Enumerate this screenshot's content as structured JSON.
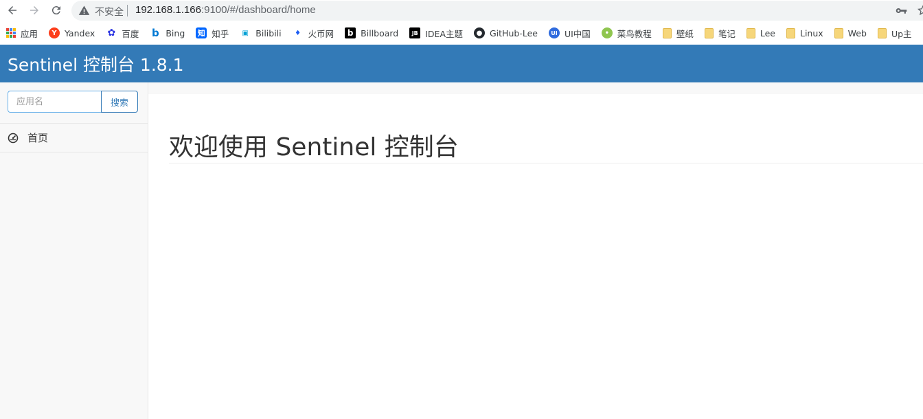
{
  "browser": {
    "security_label": "不安全",
    "url_host": "192.168.1.166",
    "url_rest": ":9100/#/dashboard/home",
    "icons": [
      "back-icon",
      "forward-icon",
      "reload-icon",
      "warning-icon",
      "key-icon",
      "star-icon"
    ]
  },
  "bookmarks": [
    {
      "label": "应用",
      "icon": "apps-icon"
    },
    {
      "label": "Yandex",
      "icon": "yandex-icon",
      "glyph": "Y"
    },
    {
      "label": "百度",
      "icon": "baidu-icon",
      "glyph": "✿"
    },
    {
      "label": "Bing",
      "icon": "bing-icon",
      "glyph": "b"
    },
    {
      "label": "知乎",
      "icon": "zhihu-icon",
      "glyph": "知"
    },
    {
      "label": "Bilibili",
      "icon": "bilibili-icon",
      "glyph": "▣"
    },
    {
      "label": "火币网",
      "icon": "huobi-icon",
      "glyph": "♦"
    },
    {
      "label": "Billboard",
      "icon": "billboard-icon",
      "glyph": "b"
    },
    {
      "label": "IDEA主题",
      "icon": "idea-icon",
      "glyph": "JB"
    },
    {
      "label": "GitHub-Lee",
      "icon": "github-icon",
      "glyph": "●"
    },
    {
      "label": "UI中国",
      "icon": "uichina-icon",
      "glyph": "UI"
    },
    {
      "label": "菜鸟教程",
      "icon": "runoob-icon",
      "glyph": "•"
    },
    {
      "label": "壁纸",
      "icon": "folder-icon"
    },
    {
      "label": "笔记",
      "icon": "folder-icon"
    },
    {
      "label": "Lee",
      "icon": "folder-icon"
    },
    {
      "label": "Linux",
      "icon": "folder-icon"
    },
    {
      "label": "Web",
      "icon": "folder-icon"
    },
    {
      "label": "Up主",
      "icon": "folder-icon"
    }
  ],
  "header": {
    "brand": "Sentinel 控制台 1.8.1",
    "color": "#337ab7"
  },
  "sidebar": {
    "search": {
      "placeholder": "应用名",
      "value": "",
      "button_label": "搜索"
    },
    "items": [
      {
        "label": "首页",
        "icon": "dashboard-icon"
      }
    ]
  },
  "main": {
    "title": "欢迎使用 Sentinel 控制台"
  }
}
